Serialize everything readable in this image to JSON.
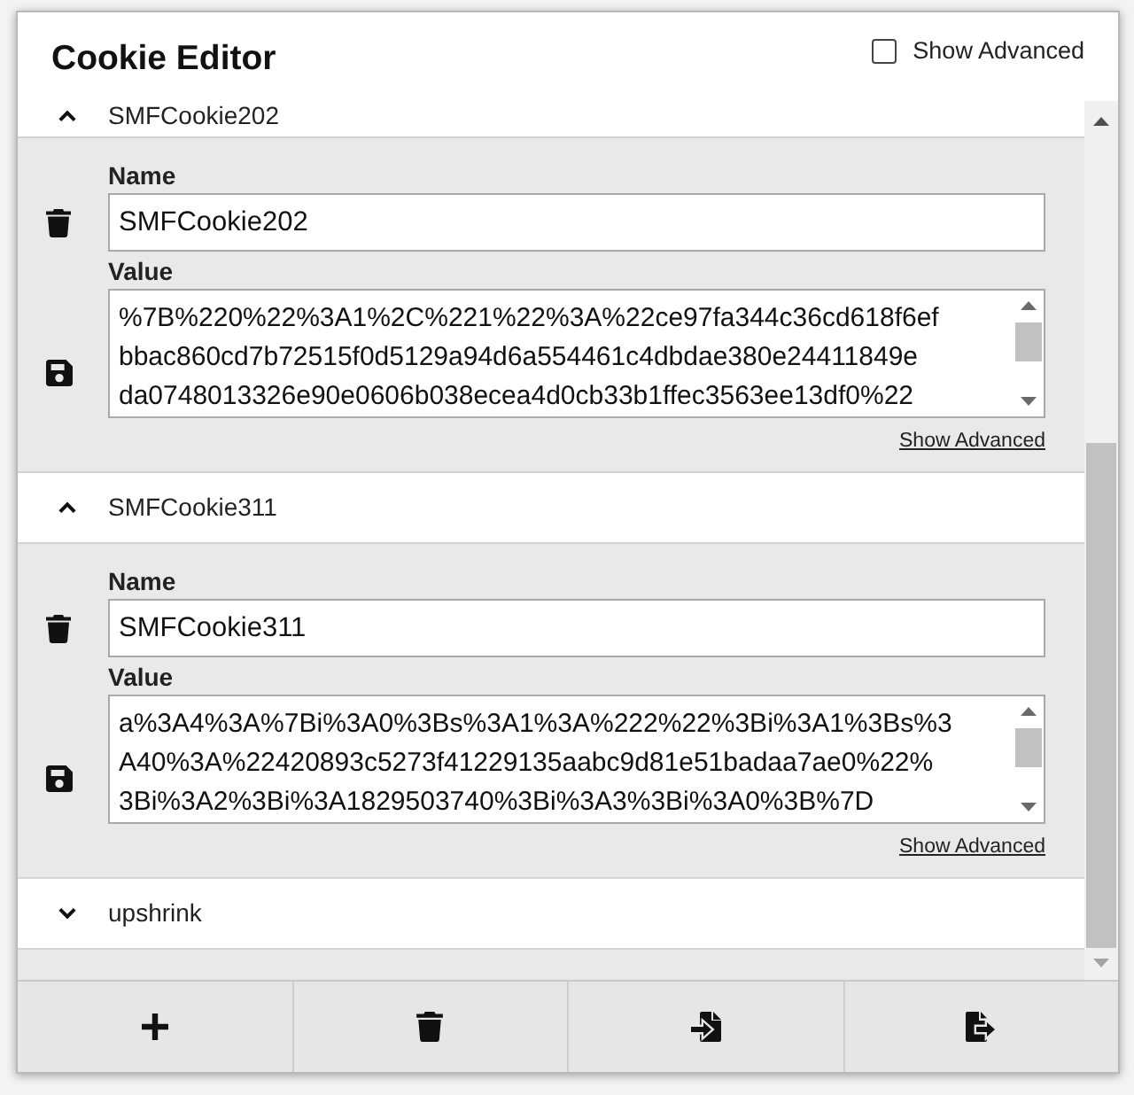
{
  "header": {
    "title": "Cookie Editor",
    "show_advanced": {
      "label": "Show Advanced",
      "checked": false
    }
  },
  "cookies": [
    {
      "title": "SMFCookie202",
      "expanded": true,
      "name_label": "Name",
      "name": "SMFCookie202",
      "value_label": "Value",
      "value": "%7B%220%22%3A1%2C%221%22%3A%22ce97fa344c36cd618f6ef\nbbac860cd7b72515f0d5129a94d6a554461c4dbdae380e24411849e\nda0748013326e90e0606b038ecea4d0cb33b1ffec3563ee13df0%22",
      "advanced_link": "Show Advanced"
    },
    {
      "title": "SMFCookie311",
      "expanded": true,
      "name_label": "Name",
      "name": "SMFCookie311",
      "value_label": "Value",
      "value": "a%3A4%3A%7Bi%3A0%3Bs%3A1%3A%222%22%3Bi%3A1%3Bs%3\nA40%3A%22420893c5273f41229135aabc9d81e51badaa7ae0%22%\n3Bi%3A2%3Bi%3A1829503740%3Bi%3A3%3Bi%3A0%3B%7D",
      "advanced_link": "Show Advanced"
    },
    {
      "title": "upshrink",
      "expanded": false
    }
  ]
}
